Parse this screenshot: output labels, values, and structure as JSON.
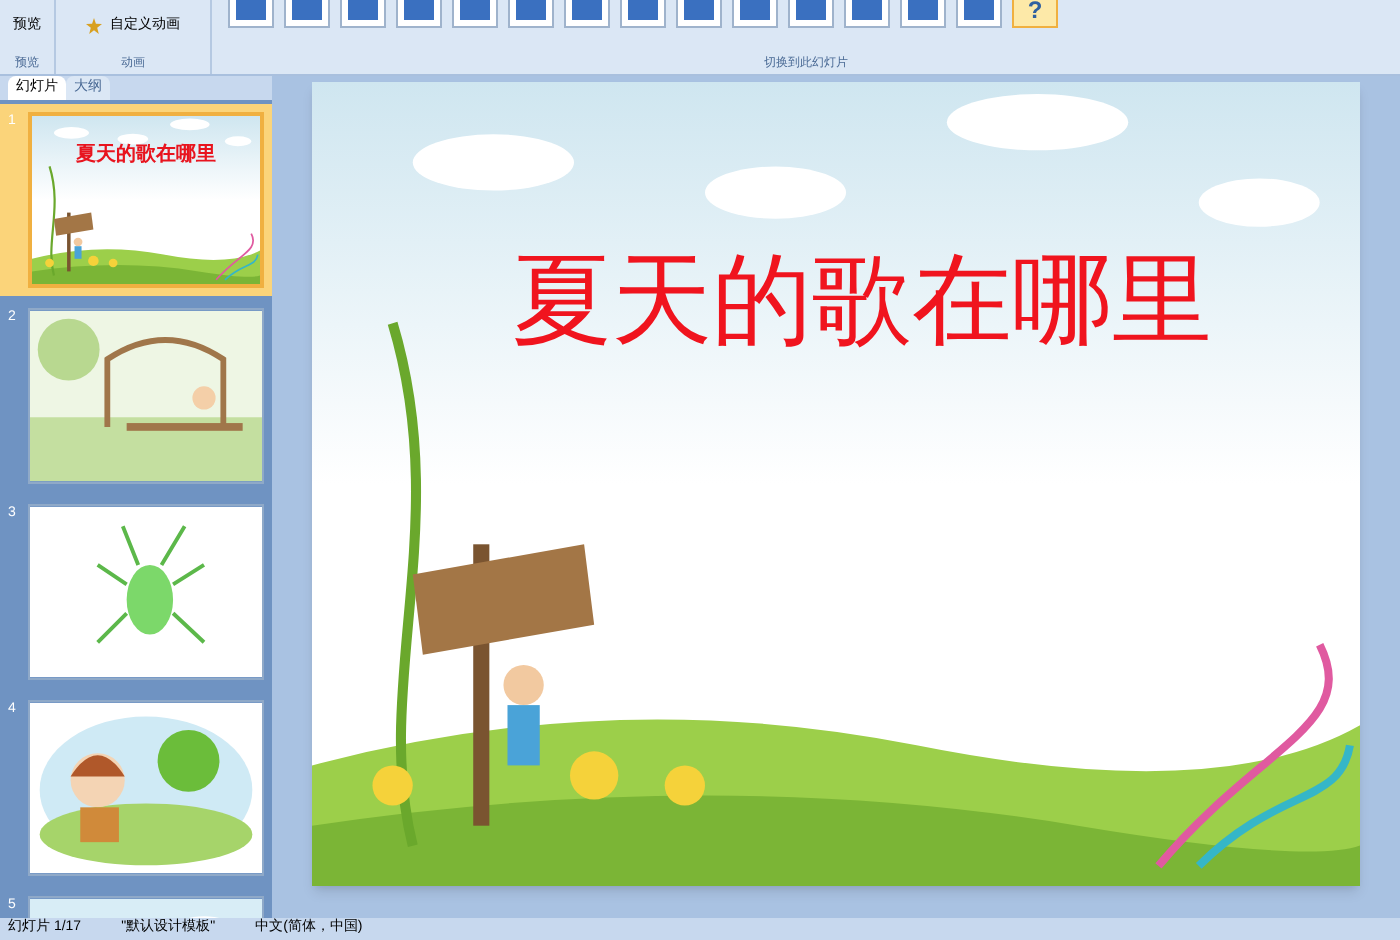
{
  "ribbon": {
    "groups": [
      {
        "label": "预览",
        "buttons": [
          {
            "label": "预览"
          }
        ]
      },
      {
        "label": "动画",
        "buttons": [
          {
            "label": "自定义动画"
          }
        ]
      },
      {
        "label": "切换到此幻灯片",
        "gallery": [
          {
            "selected": false
          },
          {
            "selected": false
          },
          {
            "selected": false
          },
          {
            "selected": false
          },
          {
            "selected": false
          },
          {
            "selected": false
          },
          {
            "selected": false
          },
          {
            "selected": false
          },
          {
            "selected": false
          },
          {
            "selected": false
          },
          {
            "selected": false
          },
          {
            "selected": false
          },
          {
            "selected": false
          },
          {
            "selected": false
          },
          {
            "selected": true,
            "label": "?"
          }
        ]
      }
    ]
  },
  "pane_tabs": [
    {
      "label": "幻灯片",
      "selected": true
    },
    {
      "label": "大纲",
      "selected": false
    }
  ],
  "thumbnails": [
    {
      "number": "1",
      "selected": true,
      "kind": "title",
      "title": "夏天的歌在哪里"
    },
    {
      "number": "2",
      "selected": false,
      "kind": "window"
    },
    {
      "number": "3",
      "selected": false,
      "kind": "insect"
    },
    {
      "number": "4",
      "selected": false,
      "kind": "girl"
    },
    {
      "number": "5",
      "selected": false,
      "kind": "sky"
    }
  ],
  "slide": {
    "title": "夏天的歌在哪里"
  },
  "status_bar": {
    "slide": "幻灯片 1/17",
    "theme": "\"默认设计模板\"",
    "language": "中文(简体，中国)"
  }
}
